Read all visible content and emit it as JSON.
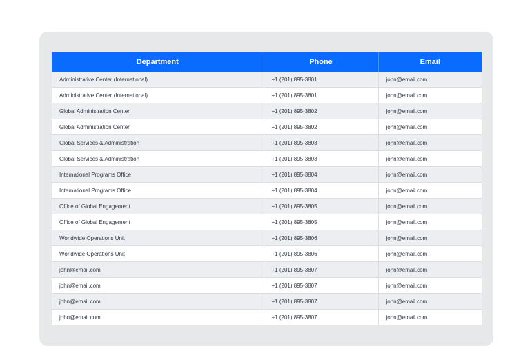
{
  "colors": {
    "header_bg": "#0a6cff",
    "header_text": "#ffffff",
    "card_bg": "#e7e8ea",
    "row_odd": "#eceef1",
    "row_even": "#ffffff"
  },
  "table": {
    "headers": [
      "Department",
      "Phone",
      "Email"
    ],
    "rows": [
      [
        "Administrative Center (International)",
        "+1 (201) 895-3801",
        "john@email.com"
      ],
      [
        "Administrative Center (International)",
        "+1 (201) 895-3801",
        "john@email.com"
      ],
      [
        "Global Administration Center",
        "+1 (201) 895-3802",
        "john@email.com"
      ],
      [
        "Global Administration Center",
        "+1 (201) 895-3802",
        "john@email.com"
      ],
      [
        "Global Services & Administration",
        "+1 (201) 895-3803",
        "john@email.com"
      ],
      [
        "Global Services & Administration",
        "+1 (201) 895-3803",
        "john@email.com"
      ],
      [
        "International Programs Office",
        "+1 (201) 895-3804",
        "john@email.com"
      ],
      [
        "International Programs Office",
        "+1 (201) 895-3804",
        "john@email.com"
      ],
      [
        "Office of Global Engagement",
        "+1 (201) 895-3805",
        "john@email.com"
      ],
      [
        "Office of Global Engagement",
        "+1 (201) 895-3805",
        "john@email.com"
      ],
      [
        "Worldwide Operations Unit",
        "+1 (201) 895-3806",
        "john@email.com"
      ],
      [
        "Worldwide Operations Unit",
        "+1 (201) 895-3806",
        "john@email.com"
      ],
      [
        "john@email.com",
        "+1 (201) 895-3807",
        "john@email.com"
      ],
      [
        "john@email.com",
        "+1 (201) 895-3807",
        "john@email.com"
      ],
      [
        "john@email.com",
        "+1 (201) 895-3807",
        "john@email.com"
      ],
      [
        "john@email.com",
        "+1 (201) 895-3807",
        "john@email.com"
      ]
    ]
  }
}
